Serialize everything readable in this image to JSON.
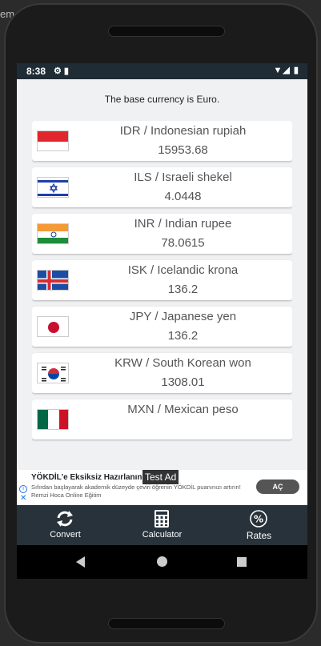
{
  "statusbar": {
    "time": "8:38",
    "left_icons": "⚙ ▮",
    "right_icons": "▼◢ ▮"
  },
  "header": {
    "base_text": "The base currency is Euro."
  },
  "currencies": [
    {
      "name": "IDR / Indonesian rupiah",
      "rate": "15953.68",
      "flag": "flag-indonesia-icon"
    },
    {
      "name": "ILS / Israeli shekel",
      "rate": "4.0448",
      "flag": "flag-israel-icon"
    },
    {
      "name": "INR / Indian rupee",
      "rate": "78.0615",
      "flag": "flag-india-icon"
    },
    {
      "name": "ISK / Icelandic krona",
      "rate": "136.2",
      "flag": "flag-iceland-icon"
    },
    {
      "name": "JPY / Japanese yen",
      "rate": "136.2",
      "flag": "flag-japan-icon"
    },
    {
      "name": "KRW / South Korean won",
      "rate": "1308.01",
      "flag": "flag-south-korea-icon"
    },
    {
      "name": "MXN / Mexican peso",
      "rate": "",
      "flag": "flag-mexico-icon"
    }
  ],
  "ad": {
    "title": "YÖKDİL'e Eksiksiz Hazırlanın",
    "badge": "Test Ad",
    "description": "Sıfırdan başlayarak akademik düzeyde çeviri öğrenin YÖKDİL puanınızı artırın! Remzi Hoca Online Eğitim",
    "button": "AÇ",
    "info_icon": "i",
    "close_icon": "✕"
  },
  "bottom_nav": {
    "items": [
      {
        "label": "Convert",
        "icon": "sync-icon"
      },
      {
        "label": "Calculator",
        "icon": "calculator-icon"
      },
      {
        "label": "Rates",
        "icon": "percent-icon"
      }
    ]
  },
  "phone_edge_text": "em"
}
